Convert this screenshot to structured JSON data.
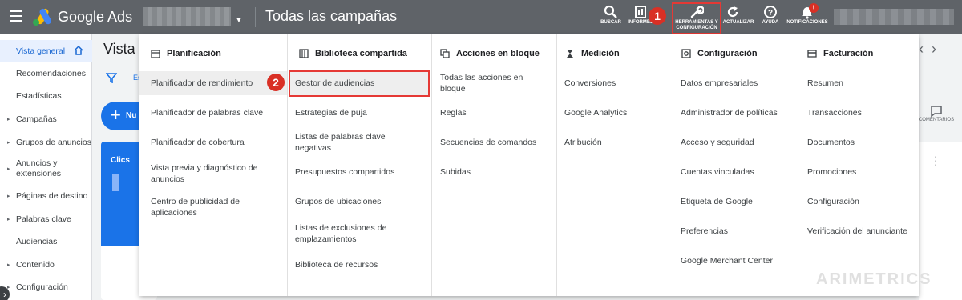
{
  "topbar": {
    "brand": "Google Ads",
    "page_title": "Todas las campañas",
    "tools": [
      {
        "label": "BUSCAR",
        "icon": "search-icon"
      },
      {
        "label": "INFORMES",
        "icon": "reports-icon"
      },
      {
        "label": "HERRAMIENTAS Y CONFIGURACIÓN",
        "icon": "wrench-icon"
      },
      {
        "label": "ACTUALIZAR",
        "icon": "refresh-icon"
      },
      {
        "label": "AYUDA",
        "icon": "help-icon"
      },
      {
        "label": "NOTIFICACIONES",
        "icon": "bell-icon"
      }
    ],
    "step1": "1",
    "notif_badge": "!"
  },
  "leftnav": {
    "items": [
      {
        "label": "Vista general"
      },
      {
        "label": "Recomendaciones"
      },
      {
        "label": "Estadísticas"
      },
      {
        "label": "Campañas"
      },
      {
        "label": "Grupos de anuncios"
      },
      {
        "label": "Anuncios y extensiones"
      },
      {
        "label": "Páginas de destino"
      },
      {
        "label": "Palabras clave"
      },
      {
        "label": "Audiencias"
      },
      {
        "label": "Contenido"
      },
      {
        "label": "Configuración"
      }
    ]
  },
  "background": {
    "title": "Vista g",
    "filter_text": "Es",
    "fab_label": "Nu",
    "card_metric": "Clics",
    "comment_label": "COMENTARIOS"
  },
  "menu": {
    "columns": [
      {
        "header": "Planificación",
        "icon": "calendar-icon",
        "items": [
          "Planificador de rendimiento",
          "Planificador de palabras clave",
          "Planificador de cobertura",
          "Vista previa y diagnóstico de anuncios",
          "Centro de publicidad de aplicaciones"
        ]
      },
      {
        "header": "Biblioteca compartida",
        "icon": "library-icon",
        "items": [
          "Gestor de audiencias",
          "Estrategias de puja",
          "Listas de palabras clave negativas",
          "Presupuestos compartidos",
          "Grupos de ubicaciones",
          "Listas de exclusiones de emplazamientos",
          "Biblioteca de recursos"
        ]
      },
      {
        "header": "Acciones en bloque",
        "icon": "bulk-actions-icon",
        "items": [
          "Todas las acciones en bloque",
          "Reglas",
          "Secuencias de comandos",
          "Subidas"
        ]
      },
      {
        "header": "Medición",
        "icon": "hourglass-icon",
        "items": [
          "Conversiones",
          "Google Analytics",
          "Atribución"
        ]
      },
      {
        "header": "Configuración",
        "icon": "settings-icon",
        "items": [
          "Datos empresariales",
          "Administrador de políticas",
          "Acceso y seguridad",
          "Cuentas vinculadas",
          "Etiqueta de Google",
          "Preferencias",
          "Google Merchant Center"
        ]
      },
      {
        "header": "Facturación",
        "icon": "credit-card-icon",
        "items": [
          "Resumen",
          "Transacciones",
          "Documentos",
          "Promociones",
          "Configuración",
          "Verificación del anunciante"
        ]
      }
    ],
    "step2": "2"
  },
  "watermark": "ARIMETRICS",
  "colors": {
    "accent": "#1a73e8",
    "highlight": "#e53935",
    "topbar": "#5f6368"
  }
}
